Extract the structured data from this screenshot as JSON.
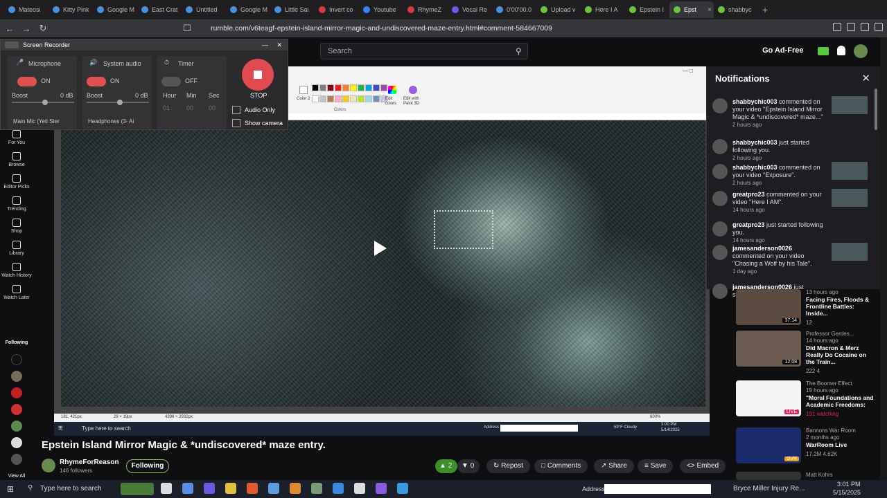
{
  "browser": {
    "tabs": [
      {
        "label": "Mateosi",
        "color": "#4a90d9"
      },
      {
        "label": "Kitty Pink",
        "color": "#4a90d9"
      },
      {
        "label": "Google M",
        "color": "#4a90d9"
      },
      {
        "label": "East Crat",
        "color": "#4a90d9"
      },
      {
        "label": "Untitled",
        "color": "#4a90d9"
      },
      {
        "label": "Google M",
        "color": "#4a90d9"
      },
      {
        "label": "Little Sai",
        "color": "#4a90d9"
      },
      {
        "label": "Invert co",
        "color": "#d23c3c"
      },
      {
        "label": "Youtube",
        "color": "#3b82f6"
      },
      {
        "label": "RhymeZ",
        "color": "#d23c3c"
      },
      {
        "label": "Vocal Re",
        "color": "#6c5ce7"
      },
      {
        "label": "0'00'00.0",
        "color": "#4a90d9"
      },
      {
        "label": "Upload v",
        "color": "#6ac43c"
      },
      {
        "label": "Here I A",
        "color": "#6ac43c"
      },
      {
        "label": "Epstein I",
        "color": "#6ac43c"
      },
      {
        "label": "Epst",
        "color": "#6ac43c",
        "active": true
      },
      {
        "label": "shabbyc",
        "color": "#6ac43c"
      }
    ],
    "url": "rumble.com/v6teagf-epstein-island-mirror-magic-and-undiscovered-maze-entry.html#comment-584667009"
  },
  "header": {
    "search_placeholder": "Search",
    "go_ad_free": "Go Ad-Free"
  },
  "left_nav": [
    {
      "label": "For You",
      "icon": "home-icon"
    },
    {
      "label": "Browse",
      "icon": "browse-icon"
    },
    {
      "label": "Editor Picks",
      "icon": "editor-picks-icon"
    },
    {
      "label": "Trending",
      "icon": "trending-icon"
    },
    {
      "label": "Shop",
      "icon": "shop-icon"
    },
    {
      "label": "Library",
      "icon": "library-icon"
    },
    {
      "label": "Watch History",
      "icon": "history-icon"
    },
    {
      "label": "Watch Later",
      "icon": "watch-later-icon"
    }
  ],
  "following_label": "Following",
  "view_all": "View All",
  "recorder": {
    "title": "Screen Recorder",
    "microphone": {
      "label": "Microphone",
      "state": "ON",
      "boost": "Boost",
      "db": "0 dB",
      "device": "Main Mic (Yeti Ster"
    },
    "system_audio": {
      "label": "System audio",
      "state": "ON",
      "boost": "Boost",
      "db": "0 dB",
      "device": "Headphones (3- Ai"
    },
    "timer": {
      "label": "Timer",
      "state": "OFF",
      "hour": "Hour",
      "min": "Min",
      "sec": "Sec",
      "h": "01",
      "m": "00",
      "s": "00"
    },
    "stop": "STOP",
    "audio_only": "Audio Only",
    "show_camera": "Show camera"
  },
  "paint": {
    "color2": "Color 2",
    "colors": "Colors",
    "edit_colors": "Edit colors",
    "edit_paint3d": "Edit with Paint 3D",
    "status_pos": "181, 421px",
    "status_sel": "29 × 19px",
    "status_size": "4396 × 2932px",
    "zoom": "600%",
    "inner_search": "Type here to search",
    "inner_address": "Address",
    "inner_weather": "59°F Cloudy",
    "inner_time": "3:00 PM",
    "inner_date": "5/14/2025"
  },
  "video": {
    "title": "Epstein Island Mirror Magic & *undiscovered* maze entry.",
    "channel": "RhymeForReason",
    "followers": "146 followers",
    "follow_label": "Following",
    "likes": "2",
    "dislikes": "0",
    "repost": "Repost",
    "comments": "Comments",
    "share": "Share",
    "save": "Save",
    "embed": "Embed"
  },
  "notifications": {
    "title": "Notifications",
    "items": [
      {
        "user": "shabbychic003",
        "text": " commented on your video \"Epstein Island Mirror Magic & *undiscovered* maze...\"",
        "time": "2 hours ago"
      },
      {
        "user": "shabbychic003",
        "text": " just started following you.",
        "time": "2 hours ago"
      },
      {
        "user": "shabbychic003",
        "text": " commented on your video \"Exposure\".",
        "time": "2 hours ago"
      },
      {
        "user": "greatpro23",
        "text": " commented on your video \"Here I AM\".",
        "time": "14 hours ago"
      },
      {
        "user": "greatpro23",
        "text": " just started following you.",
        "time": "14 hours ago"
      },
      {
        "user": "jamesanderson0026",
        "text": " commented on your video \"Chasing a Wolf by his Tale\".",
        "time": "1 day ago"
      },
      {
        "user": "jamesanderson0026",
        "text": " just started following",
        "time": ""
      }
    ]
  },
  "related": [
    {
      "channel": "",
      "time": "13 hours ago",
      "title": "Facing Fires, Floods & Frontline Battles: Inside...",
      "views": "12",
      "duration": "37:14",
      "extra": ""
    },
    {
      "channel": "Professor Gerdes...",
      "time": "14 hours ago",
      "title": "Did Macron & Merz Really Do Cocaine on the Train...",
      "views": "222",
      "comments": "4",
      "duration": "12:08"
    },
    {
      "channel": "The Boomer Effect",
      "time": "19 hours ago",
      "title": "\"Moral Foundations and Academic Freedoms:",
      "views": "191 watching",
      "duration": "LIVE"
    },
    {
      "channel": "Bannons War Room",
      "time": "2 months ago",
      "title": "WarRoom Live",
      "views": "17.2M",
      "comments": "4.62K",
      "duration": "DVR"
    },
    {
      "channel": "Matt Kohrs",
      "time": "",
      "title": "",
      "views": "",
      "duration": ""
    }
  ],
  "taskbar": {
    "search": "Type here to search",
    "address": "Address",
    "news": "Bryce Miller Injury Re...",
    "time": "3:01 PM",
    "date": "5/15/2025"
  }
}
